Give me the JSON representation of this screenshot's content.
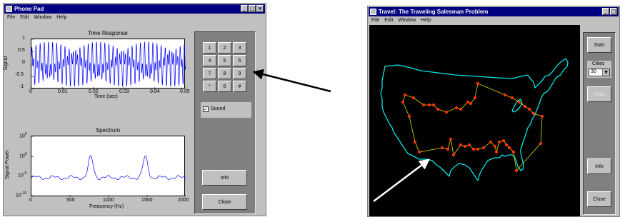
{
  "phone_window": {
    "title": "Phone Pad",
    "menu": [
      "File",
      "Edit",
      "Window",
      "Help"
    ],
    "time_plot": {
      "title": "Time Response",
      "xlabel": "Time (sec)",
      "ylabel": "Signal",
      "yticks": [
        "1",
        "0.5",
        "0",
        "-0.5",
        "-1"
      ],
      "xticks": [
        "0",
        "0.01",
        "0.02",
        "0.03",
        "0.04",
        "0.05"
      ],
      "line_color": "#0000ff"
    },
    "spectrum_plot": {
      "title": "Spectrum",
      "xlabel": "Frequency (Hz)",
      "ylabel": "Signal Power",
      "ytick_bases": [
        "10",
        "10",
        "10",
        "10"
      ],
      "ytick_exps": [
        "5",
        "0",
        "-5",
        "-10"
      ],
      "xticks": [
        "0",
        "500",
        "1000",
        "1500",
        "2000"
      ],
      "line_color": "#0000ff"
    },
    "keypad": [
      "1",
      "2",
      "3",
      "4",
      "5",
      "6",
      "7",
      "8",
      "9",
      "*",
      "0",
      "#"
    ],
    "sound_label": "Sound",
    "sound_checked": true,
    "info_label": "Info",
    "close_label": "Close"
  },
  "travel_window": {
    "title": "Travel: The Traveling Salesman Problem",
    "menu": [
      "File",
      "Edit",
      "Window",
      "Help"
    ],
    "start_label": "Start",
    "cities_label": "Cities",
    "cities_value": "30",
    "stop_label": "Stop",
    "info_label": "Info",
    "close_label": "Close",
    "map_outline_color": "#00e5e5",
    "route_color": "#e8d800",
    "city_color": "#ff3300"
  },
  "colors": {
    "titlebar": "#000080",
    "window_face": "#c0c0c0",
    "panel": "#808080",
    "arrow": "#000000",
    "map_background": "#000000"
  }
}
